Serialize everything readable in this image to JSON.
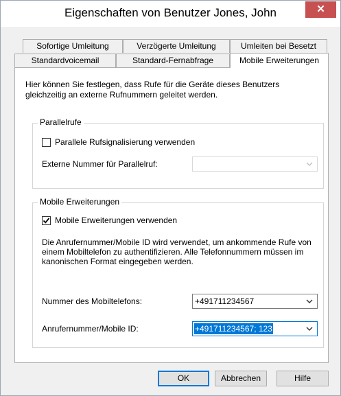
{
  "window": {
    "title": "Eigenschaften von Benutzer Jones, John",
    "close_glyph": "✕"
  },
  "tabs": {
    "row1": [
      "Sofortige Umleitung",
      "Verzögerte Umleitung",
      "Umleiten bei Besetzt"
    ],
    "row2": [
      "Standardvoicemail",
      "Standard-Fernabfrage",
      "Mobile Erweiterungen"
    ],
    "active": "Mobile Erweiterungen"
  },
  "intro": "Hier können Sie festlegen, dass Rufe für die Geräte dieses Benutzers gleichzeitig an externe Rufnummern geleitet werden.",
  "parallel": {
    "title": "Parallelrufe",
    "checkbox_label": "Parallele Rufsignalisierung verwenden",
    "checked": false,
    "external_label": "Externe Nummer für Parallelruf:",
    "external_value": ""
  },
  "mobile": {
    "title": "Mobile Erweiterungen",
    "checkbox_label": "Mobile Erweiterungen verwenden",
    "checked": true,
    "description": "Die Anrufernummer/Mobile ID wird verwendet, um ankommende Rufe von einem Mobiltelefon zu authentifizieren. Alle Telefonnummern müssen im kanonischen Format eingegeben werden.",
    "phone_label": "Nummer des Mobiltelefons:",
    "phone_value": "+491711234567",
    "caller_label": "Anrufernummer/Mobile ID:",
    "caller_value": "+491711234567; 123"
  },
  "buttons": {
    "ok": "OK",
    "cancel": "Abbrechen",
    "help": "Hilfe"
  },
  "colors": {
    "accent": "#0078d7",
    "close": "#c75050"
  }
}
